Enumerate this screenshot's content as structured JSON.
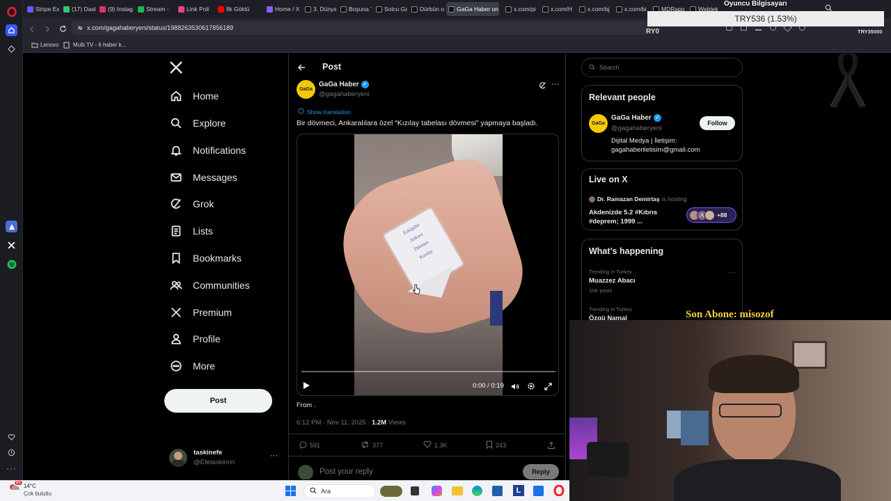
{
  "tabs": [
    {
      "label": "Stripe Ex",
      "color": "#635bff"
    },
    {
      "label": "(17) Dash",
      "color": "#2ecc71"
    },
    {
      "label": "(9) Instag",
      "color": "#e1306c"
    },
    {
      "label": "Stream -",
      "color": "#1db954"
    },
    {
      "label": "Link Poli",
      "color": "#e84393"
    },
    {
      "label": "İlk Göktü",
      "color": "#ff0000"
    },
    {
      "label": "Home / X",
      "color": "#8a5cf6"
    },
    {
      "label": "3. Dünya",
      "color": "#111"
    },
    {
      "label": "Boşuna T",
      "color": "#111"
    },
    {
      "label": "Solcu Ga",
      "color": "#111"
    },
    {
      "label": "Dürbün o",
      "color": "#111"
    },
    {
      "label": "GaGa Haber on",
      "color": "#111"
    },
    {
      "label": "x.com/pi",
      "color": "#111"
    },
    {
      "label": "x.com/H",
      "color": "#111"
    },
    {
      "label": "x.com/bj",
      "color": "#111"
    },
    {
      "label": "x.com/bi",
      "color": "#111"
    },
    {
      "label": "MDRapo",
      "color": "#111"
    },
    {
      "label": "Webtek",
      "color": "#111"
    }
  ],
  "address": {
    "url": "x.com/gagahaberyeni/status/1988263530617856189"
  },
  "bookmarks": {
    "item1": "Lenovo",
    "item2": "Multi TV - 6 haber k..."
  },
  "nav": {
    "items": [
      "Home",
      "Explore",
      "Notifications",
      "Messages",
      "Grok",
      "Lists",
      "Bookmarks",
      "Communities",
      "Premium",
      "Profile",
      "More"
    ],
    "post_button": "Post",
    "user_name": "taskinefe",
    "user_handle": "@Efetaskinnn",
    "more_dots": "···"
  },
  "post": {
    "header": "Post",
    "author_name": "GaGa Haber",
    "author_handle": "@gagahaberyeni",
    "avatar_text": "GaGa",
    "translate": "Show translation",
    "text": "Bir dövmeci, Ankaralılara özel “Kızılay tabelası dövmesi” yapmaya başladı.",
    "video_time": "0:00 / 0:19",
    "from": "From .",
    "timestamp": "6:12 PM · Nov 11, 2025 · ",
    "views_count": "1.2M",
    "views_label": " Views",
    "replies": "591",
    "reposts": "377",
    "likes": "1.3K",
    "bookmarks": "243",
    "reply_placeholder": "Post your reply",
    "reply_button": "Reply",
    "tattoo_lines": [
      "Eskişehir",
      "Ankara",
      "Dikmen",
      "Kızılay"
    ]
  },
  "sidebar": {
    "search_placeholder": "Search",
    "relevant_title": "Relevant people",
    "rp_name": "GaGa Haber",
    "rp_handle": "@gagahaberyeni",
    "rp_follow": "Follow",
    "rp_bio": "Dijital Medya | İletişim: gagahaberiletisim@gmail.com",
    "live_title": "Live on X",
    "live_host": "Dr. Ramazan Demirtaş",
    "live_hosting": " is hosting",
    "live_text": "Akdenizde 5.2 #Kıbrıs #deprem; 1999 ...",
    "live_count": "+88",
    "live_avatar_letter": "A",
    "happening_title": "What’s happening",
    "trend1_meta": "Trending in Turkey",
    "trend1_name": "Muazzez Abacı",
    "trend1_posts": "10K posts",
    "trend2_meta": "Trending in Turkey",
    "trend2_name": "Özgü Namal"
  },
  "overlay": {
    "ticker": "TRY536 (1.53%)",
    "oyuncu": "Oyuncu Bilgisayarı",
    "try_left": "RY0",
    "try_right": "TRY35000",
    "son_abone": "Son Abone: misozof"
  },
  "taskbar": {
    "temp": "14°C",
    "weather": "Çok bulutlu",
    "search": "Ara",
    "badge": "9+"
  },
  "colors": {
    "accent": "#1d9bf0",
    "gaga_yellow": "#f5c800",
    "live_purple": "#7856ff"
  }
}
